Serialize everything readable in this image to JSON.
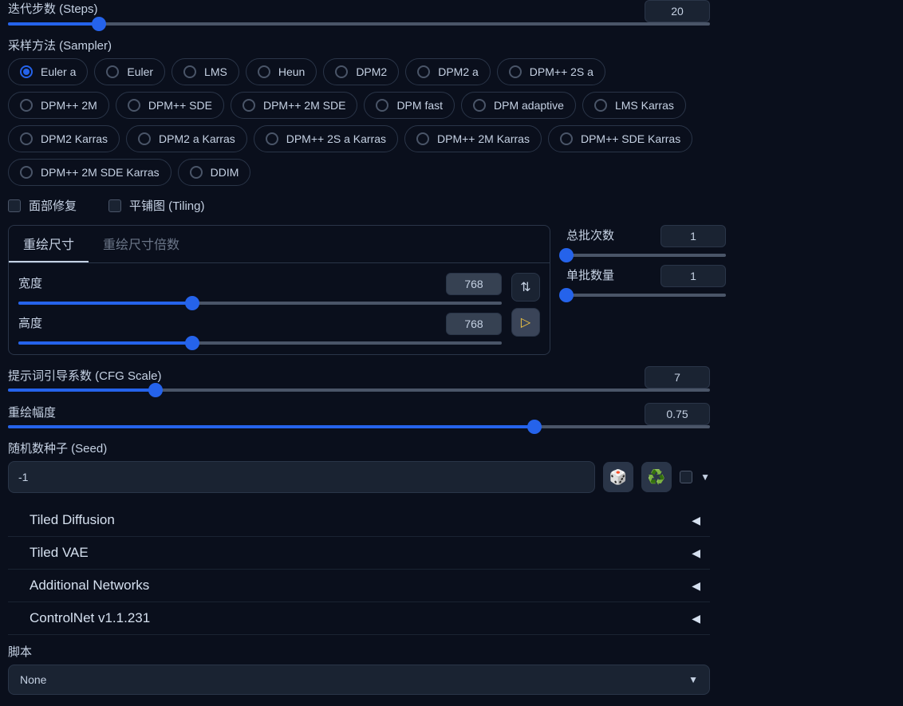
{
  "steps": {
    "label": "迭代步数 (Steps)",
    "value": "20",
    "pct": 13
  },
  "sampler": {
    "label": "采样方法 (Sampler)",
    "selected": "Euler a",
    "options": [
      "Euler a",
      "Euler",
      "LMS",
      "Heun",
      "DPM2",
      "DPM2 a",
      "DPM++ 2S a",
      "DPM++ 2M",
      "DPM++ SDE",
      "DPM++ 2M SDE",
      "DPM fast",
      "DPM adaptive",
      "LMS Karras",
      "DPM2 Karras",
      "DPM2 a Karras",
      "DPM++ 2S a Karras",
      "DPM++ 2M Karras",
      "DPM++ SDE Karras",
      "DPM++ 2M SDE Karras",
      "DDIM"
    ]
  },
  "checks": {
    "face_restore": "面部修复",
    "tiling": "平铺图 (Tiling)"
  },
  "size_tabs": {
    "tab1": "重绘尺寸",
    "tab2": "重绘尺寸倍数"
  },
  "width": {
    "label": "宽度",
    "value": "768",
    "pct": 36
  },
  "height": {
    "label": "高度",
    "value": "768",
    "pct": 36
  },
  "batch_count": {
    "label": "总批次数",
    "value": "1",
    "pct": 0
  },
  "batch_size": {
    "label": "单批数量",
    "value": "1",
    "pct": 0
  },
  "cfg": {
    "label": "提示词引导系数 (CFG Scale)",
    "value": "7",
    "pct": 21
  },
  "denoise": {
    "label": "重绘幅度",
    "value": "0.75",
    "pct": 75
  },
  "seed": {
    "label": "随机数种子 (Seed)",
    "value": "-1"
  },
  "accordions": [
    "Tiled Diffusion",
    "Tiled VAE",
    "Additional Networks",
    "ControlNet v1.1.231"
  ],
  "script": {
    "label": "脚本",
    "selected": "None"
  }
}
